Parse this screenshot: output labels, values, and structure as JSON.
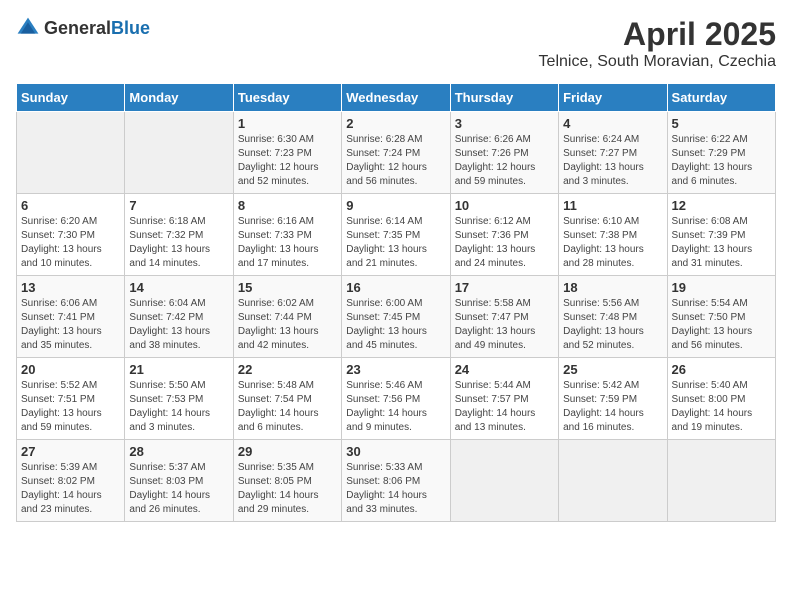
{
  "header": {
    "logo_general": "General",
    "logo_blue": "Blue",
    "title": "April 2025",
    "subtitle": "Telnice, South Moravian, Czechia"
  },
  "weekdays": [
    "Sunday",
    "Monday",
    "Tuesday",
    "Wednesday",
    "Thursday",
    "Friday",
    "Saturday"
  ],
  "weeks": [
    [
      {
        "day": "",
        "info": ""
      },
      {
        "day": "",
        "info": ""
      },
      {
        "day": "1",
        "info": "Sunrise: 6:30 AM\nSunset: 7:23 PM\nDaylight: 12 hours\nand 52 minutes."
      },
      {
        "day": "2",
        "info": "Sunrise: 6:28 AM\nSunset: 7:24 PM\nDaylight: 12 hours\nand 56 minutes."
      },
      {
        "day": "3",
        "info": "Sunrise: 6:26 AM\nSunset: 7:26 PM\nDaylight: 12 hours\nand 59 minutes."
      },
      {
        "day": "4",
        "info": "Sunrise: 6:24 AM\nSunset: 7:27 PM\nDaylight: 13 hours\nand 3 minutes."
      },
      {
        "day": "5",
        "info": "Sunrise: 6:22 AM\nSunset: 7:29 PM\nDaylight: 13 hours\nand 6 minutes."
      }
    ],
    [
      {
        "day": "6",
        "info": "Sunrise: 6:20 AM\nSunset: 7:30 PM\nDaylight: 13 hours\nand 10 minutes."
      },
      {
        "day": "7",
        "info": "Sunrise: 6:18 AM\nSunset: 7:32 PM\nDaylight: 13 hours\nand 14 minutes."
      },
      {
        "day": "8",
        "info": "Sunrise: 6:16 AM\nSunset: 7:33 PM\nDaylight: 13 hours\nand 17 minutes."
      },
      {
        "day": "9",
        "info": "Sunrise: 6:14 AM\nSunset: 7:35 PM\nDaylight: 13 hours\nand 21 minutes."
      },
      {
        "day": "10",
        "info": "Sunrise: 6:12 AM\nSunset: 7:36 PM\nDaylight: 13 hours\nand 24 minutes."
      },
      {
        "day": "11",
        "info": "Sunrise: 6:10 AM\nSunset: 7:38 PM\nDaylight: 13 hours\nand 28 minutes."
      },
      {
        "day": "12",
        "info": "Sunrise: 6:08 AM\nSunset: 7:39 PM\nDaylight: 13 hours\nand 31 minutes."
      }
    ],
    [
      {
        "day": "13",
        "info": "Sunrise: 6:06 AM\nSunset: 7:41 PM\nDaylight: 13 hours\nand 35 minutes."
      },
      {
        "day": "14",
        "info": "Sunrise: 6:04 AM\nSunset: 7:42 PM\nDaylight: 13 hours\nand 38 minutes."
      },
      {
        "day": "15",
        "info": "Sunrise: 6:02 AM\nSunset: 7:44 PM\nDaylight: 13 hours\nand 42 minutes."
      },
      {
        "day": "16",
        "info": "Sunrise: 6:00 AM\nSunset: 7:45 PM\nDaylight: 13 hours\nand 45 minutes."
      },
      {
        "day": "17",
        "info": "Sunrise: 5:58 AM\nSunset: 7:47 PM\nDaylight: 13 hours\nand 49 minutes."
      },
      {
        "day": "18",
        "info": "Sunrise: 5:56 AM\nSunset: 7:48 PM\nDaylight: 13 hours\nand 52 minutes."
      },
      {
        "day": "19",
        "info": "Sunrise: 5:54 AM\nSunset: 7:50 PM\nDaylight: 13 hours\nand 56 minutes."
      }
    ],
    [
      {
        "day": "20",
        "info": "Sunrise: 5:52 AM\nSunset: 7:51 PM\nDaylight: 13 hours\nand 59 minutes."
      },
      {
        "day": "21",
        "info": "Sunrise: 5:50 AM\nSunset: 7:53 PM\nDaylight: 14 hours\nand 3 minutes."
      },
      {
        "day": "22",
        "info": "Sunrise: 5:48 AM\nSunset: 7:54 PM\nDaylight: 14 hours\nand 6 minutes."
      },
      {
        "day": "23",
        "info": "Sunrise: 5:46 AM\nSunset: 7:56 PM\nDaylight: 14 hours\nand 9 minutes."
      },
      {
        "day": "24",
        "info": "Sunrise: 5:44 AM\nSunset: 7:57 PM\nDaylight: 14 hours\nand 13 minutes."
      },
      {
        "day": "25",
        "info": "Sunrise: 5:42 AM\nSunset: 7:59 PM\nDaylight: 14 hours\nand 16 minutes."
      },
      {
        "day": "26",
        "info": "Sunrise: 5:40 AM\nSunset: 8:00 PM\nDaylight: 14 hours\nand 19 minutes."
      }
    ],
    [
      {
        "day": "27",
        "info": "Sunrise: 5:39 AM\nSunset: 8:02 PM\nDaylight: 14 hours\nand 23 minutes."
      },
      {
        "day": "28",
        "info": "Sunrise: 5:37 AM\nSunset: 8:03 PM\nDaylight: 14 hours\nand 26 minutes."
      },
      {
        "day": "29",
        "info": "Sunrise: 5:35 AM\nSunset: 8:05 PM\nDaylight: 14 hours\nand 29 minutes."
      },
      {
        "day": "30",
        "info": "Sunrise: 5:33 AM\nSunset: 8:06 PM\nDaylight: 14 hours\nand 33 minutes."
      },
      {
        "day": "",
        "info": ""
      },
      {
        "day": "",
        "info": ""
      },
      {
        "day": "",
        "info": ""
      }
    ]
  ]
}
